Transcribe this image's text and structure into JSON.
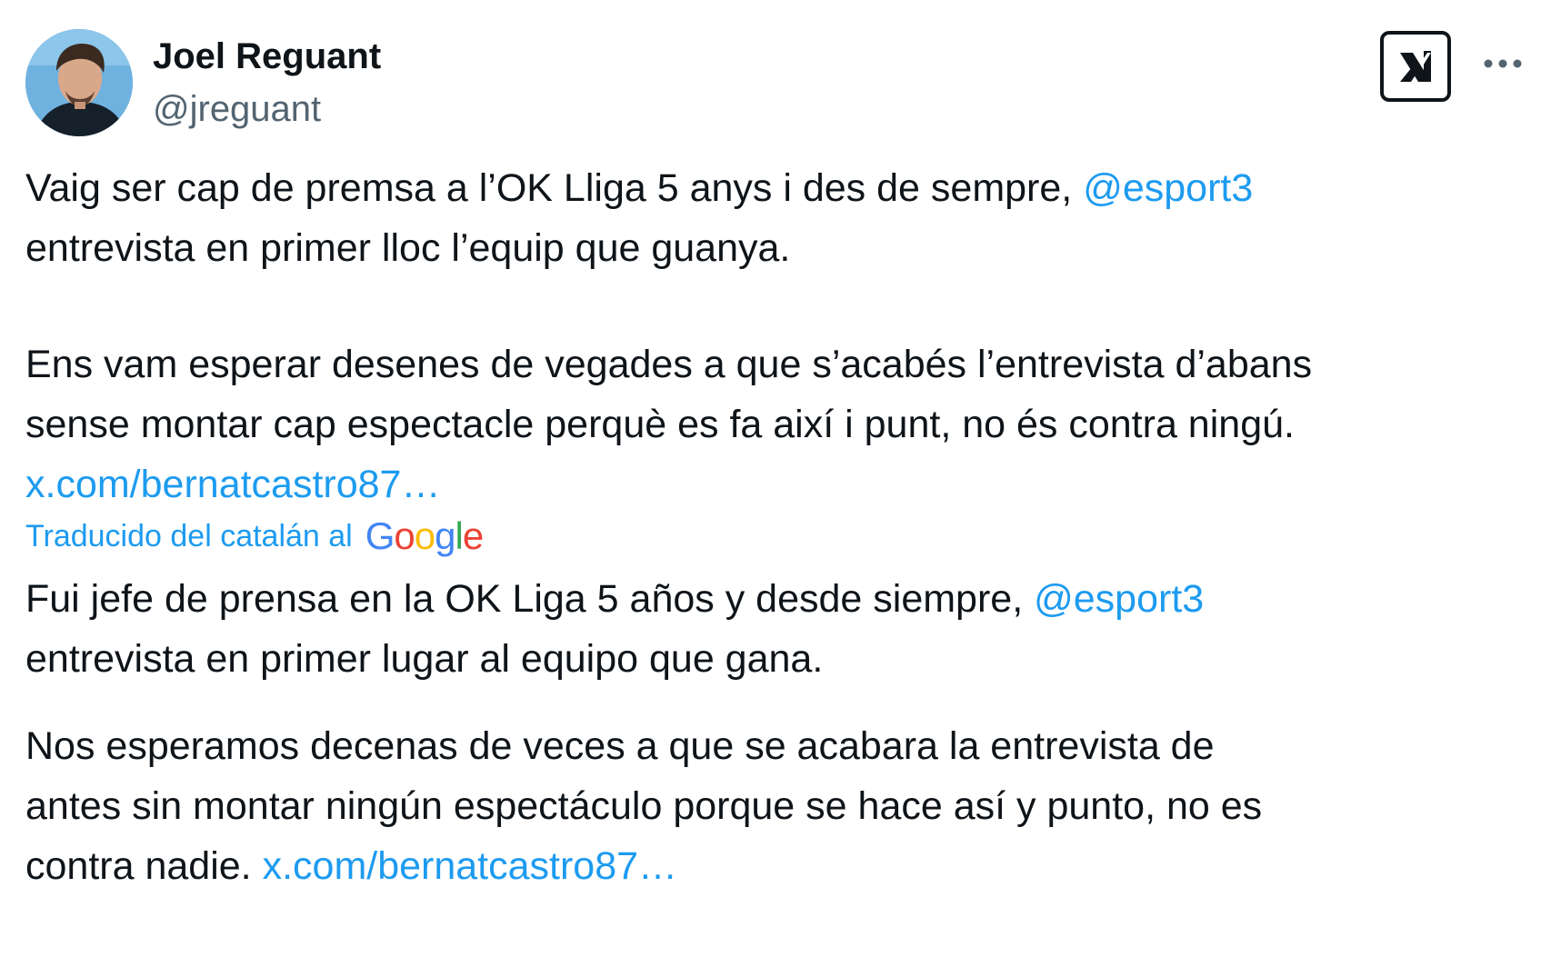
{
  "author": {
    "name": "Joel Reguant",
    "handle": "@jreguant"
  },
  "header_icons": {
    "grok": "grok-icon",
    "more": "more-icon"
  },
  "original": {
    "p1_text_1": "Vaig ser cap de premsa a l’OK Lliga 5 anys i des de sempre,",
    "p1_mention": "@esport3",
    "p1_text_2": "entrevista en primer lloc l’equip que guanya.",
    "p2_line_1": "Ens vam esperar desenes de vegades a que s’acabés l’entrevista d’abans",
    "p2_line_2": "sense montar cap espectacle perquè es fa així i punt, no és contra ningú.",
    "p2_link": "x.com/bernatcastro87…"
  },
  "translation": {
    "label": "Traducido del catalán al",
    "provider": "Google",
    "p1_text_1": "Fui jefe de prensa en la OK Liga 5 años y desde siempre,",
    "p1_mention": "@esport3",
    "p1_text_2": "entrevista en primer lugar al equipo que gana.",
    "p2_line_1": "Nos esperamos decenas de veces a que se acabara la entrevista de",
    "p2_line_2": "antes sin montar ningún espectáculo porque se hace así y punto, no es",
    "p2_line_3": "contra nadie.",
    "p2_link": "x.com/bernatcastro87…"
  },
  "colors": {
    "text": "#0f1419",
    "secondary": "#536471",
    "link": "#1d9bf0",
    "background": "#ffffff"
  }
}
